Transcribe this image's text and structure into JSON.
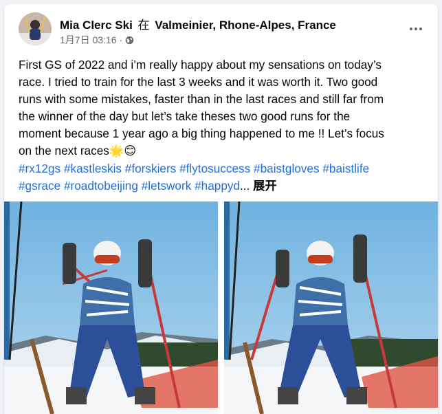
{
  "post": {
    "author": "Mia Clerc Ski",
    "location_prefix": "在",
    "location": "Valmeinier, Rhone-Alpes, France",
    "date": "1月7日 03:16",
    "separator": "·",
    "privacy_icon": "globe-icon",
    "more_icon": "more-options-icon",
    "text_lines": [
      "First GS of 2022 and i’m really happy about my sensations on today’s",
      "race. I tried to train for the last 3 weeks and it was worth it. Two good",
      "runs with some mistakes, faster than in the last races and still far from",
      "the winner of the day but let’s take theses two good runs for the",
      "moment because 1 year ago a big thing happened to me !! Let’s focus",
      "on the next races"
    ],
    "emojis": "🌟😊",
    "hashtags_line1": [
      "#rx12gs",
      "#kastleskis",
      "#forskiers",
      "#flytosuccess",
      "#baistgloves",
      "#baistlife"
    ],
    "hashtags_line2": [
      "#gsrace",
      "#roadtobeijing",
      "#letswork",
      "#happyd"
    ],
    "ellipsis": "...",
    "see_more": "展开"
  },
  "colors": {
    "link": "#216fdb",
    "text": "#050505",
    "meta": "#65676b",
    "background": "#f0f2f5"
  },
  "photos": [
    {
      "icon": "ski-racer-photo"
    },
    {
      "icon": "ski-racer-photo"
    }
  ]
}
